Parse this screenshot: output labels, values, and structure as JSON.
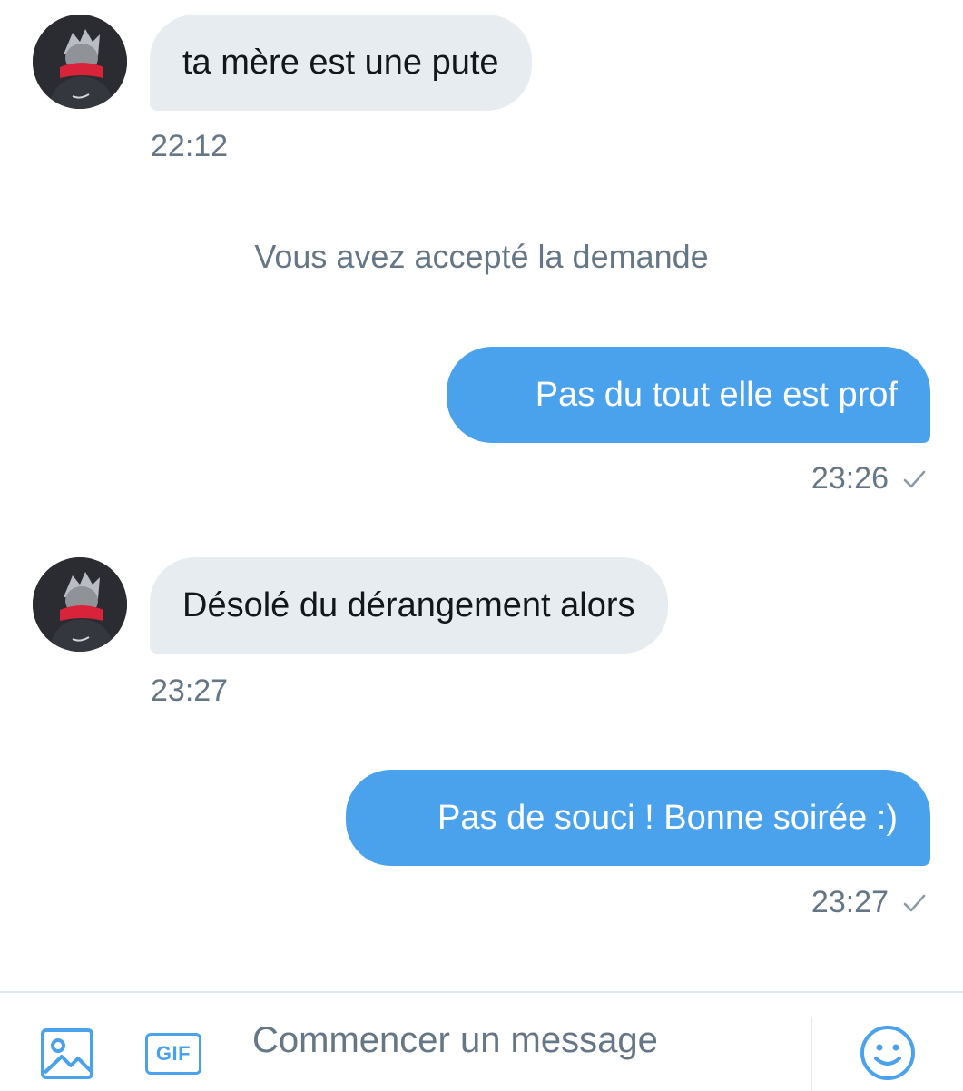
{
  "messages": [
    {
      "direction": "in",
      "text": "ta mère est une pute",
      "time": "22:12"
    },
    {
      "direction": "out",
      "text": "Pas du tout elle est prof",
      "time": "23:26",
      "status": "sent"
    },
    {
      "direction": "in",
      "text": "Désolé du dérangement alors",
      "time": "23:27"
    },
    {
      "direction": "out",
      "text": "Pas de souci ! Bonne soirée :)",
      "time": "23:27",
      "status": "sent"
    }
  ],
  "system_notice": "Vous avez accepté la demande",
  "composer": {
    "placeholder": "Commencer un message",
    "media_icon": "image-icon",
    "gif_label": "GIF",
    "emoji_icon": "emoji-icon"
  },
  "colors": {
    "accent": "#4aa1ec",
    "incoming_bubble": "#e6ecf0",
    "secondary_text": "#657786",
    "divider": "#e1e8ed"
  }
}
